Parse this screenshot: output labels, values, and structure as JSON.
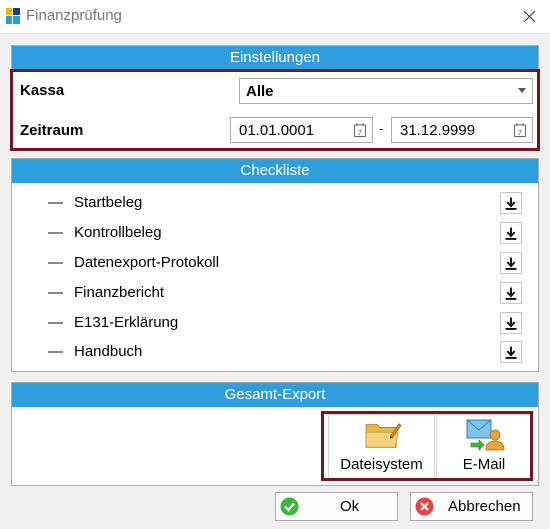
{
  "window": {
    "title": "Finanzprüfung"
  },
  "settings": {
    "header": "Einstellungen",
    "kassa_label": "Kassa",
    "kassa_value": "Alle",
    "zeitraum_label": "Zeitraum",
    "date_from": "01.01.0001",
    "date_to": "31.12.9999",
    "range_separator": "-"
  },
  "checklist": {
    "header": "Checkliste",
    "items": [
      {
        "label": "Startbeleg"
      },
      {
        "label": "Kontrollbeleg"
      },
      {
        "label": "Datenexport-Protokoll"
      },
      {
        "label": "Finanzbericht"
      },
      {
        "label": "E131-Erklärung"
      },
      {
        "label": "Handbuch"
      }
    ]
  },
  "export": {
    "header": "Gesamt-Export",
    "filesystem_label": "Dateisystem",
    "email_label": "E-Mail"
  },
  "footer": {
    "ok_label": "Ok",
    "cancel_label": "Abbrechen"
  },
  "colors": {
    "header_blue": "#2e9ddd",
    "highlight": "#7a1320",
    "ok_green": "#3cb93c",
    "cancel_red": "#e04848"
  }
}
